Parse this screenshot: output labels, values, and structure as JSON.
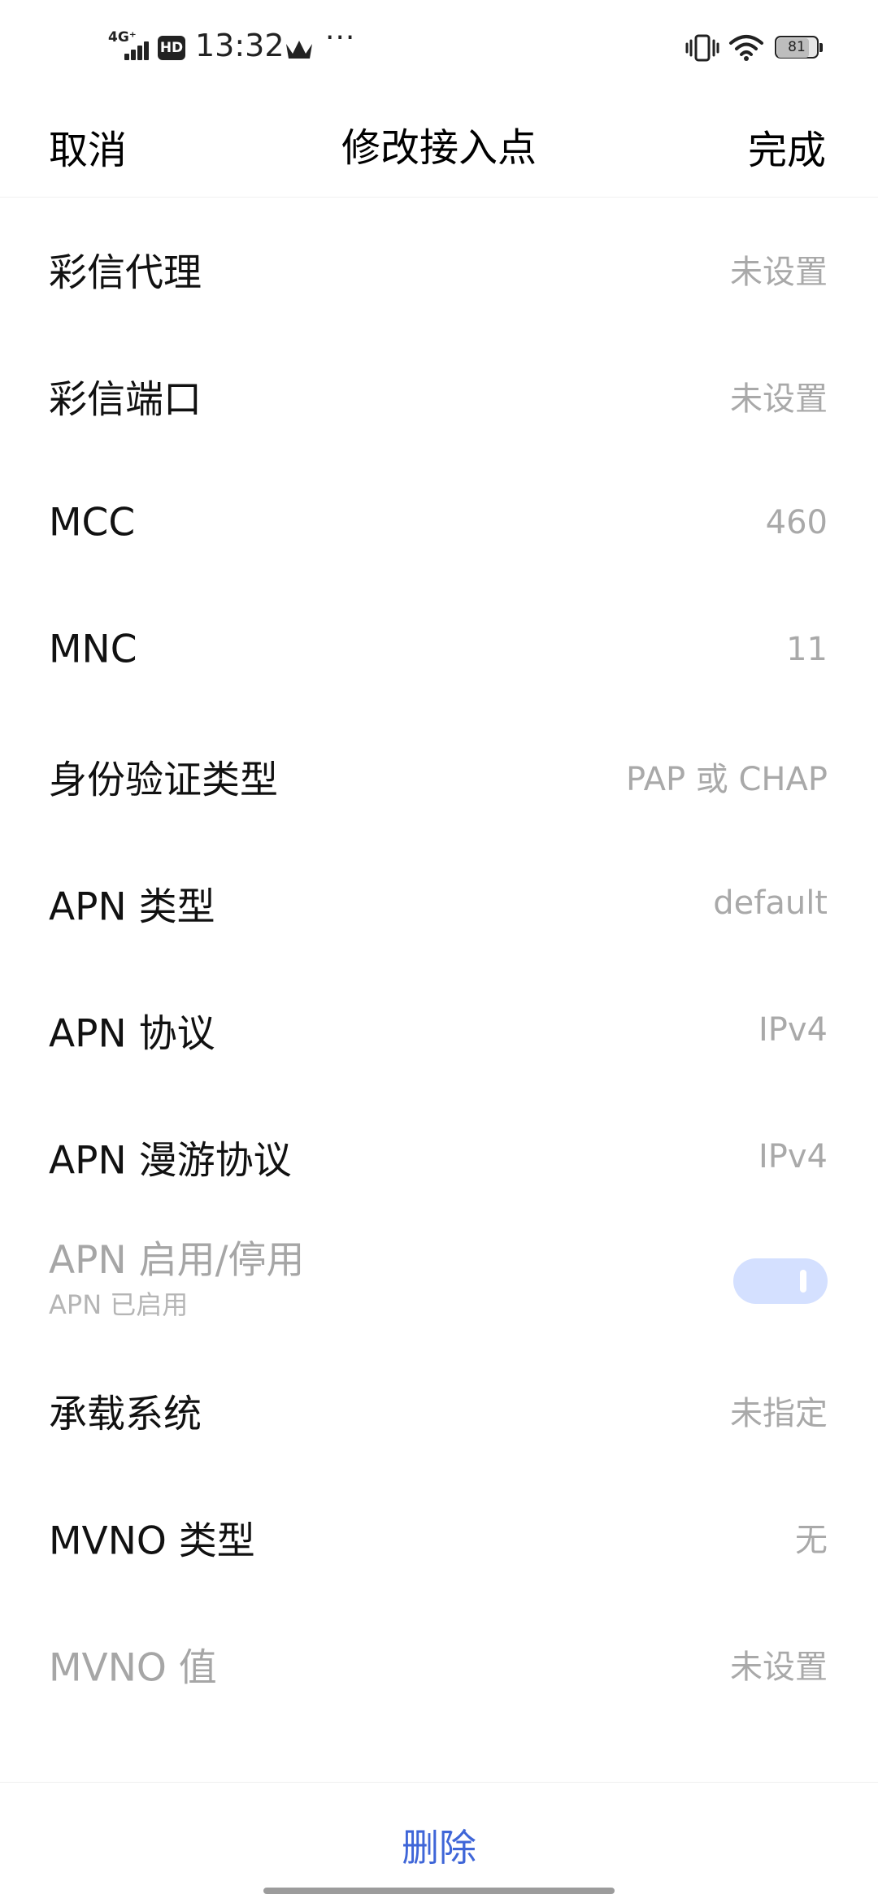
{
  "status_bar": {
    "network": "4G⁺",
    "hd_badge": "HD",
    "time": "13:32",
    "more": "···",
    "battery_level": "81",
    "icons": [
      "signal-icon",
      "crown-icon",
      "vibrate-icon",
      "wifi-icon",
      "battery-icon"
    ]
  },
  "header": {
    "cancel_label": "取消",
    "title": "修改接入点",
    "done_label": "完成"
  },
  "settings": {
    "mms_proxy": {
      "label": "彩信代理",
      "value": "未设置"
    },
    "mms_port": {
      "label": "彩信端口",
      "value": "未设置"
    },
    "mcc": {
      "label": "MCC",
      "value": "460"
    },
    "mnc": {
      "label": "MNC",
      "value": "11"
    },
    "auth_type": {
      "label": "身份验证类型",
      "value": "PAP 或 CHAP"
    },
    "apn_type": {
      "label": "APN 类型",
      "value": "default"
    },
    "apn_protocol": {
      "label": "APN 协议",
      "value": "IPv4"
    },
    "apn_roaming_protocol": {
      "label": "APN 漫游协议",
      "value": "IPv4"
    },
    "apn_enable": {
      "label": "APN 启用/停用",
      "sublabel": "APN 已启用",
      "enabled": true
    },
    "bearer": {
      "label": "承载系统",
      "value": "未指定"
    },
    "mvno_type": {
      "label": "MVNO 类型",
      "value": "无"
    },
    "mvno_value": {
      "label": "MVNO 值",
      "value": "未设置"
    }
  },
  "footer": {
    "delete_label": "删除"
  },
  "colors": {
    "accent": "#3f66d8",
    "toggle_bg": "#d4e0ff",
    "value_text": "#a9a9a9",
    "disabled_text": "#a6a6a6"
  }
}
